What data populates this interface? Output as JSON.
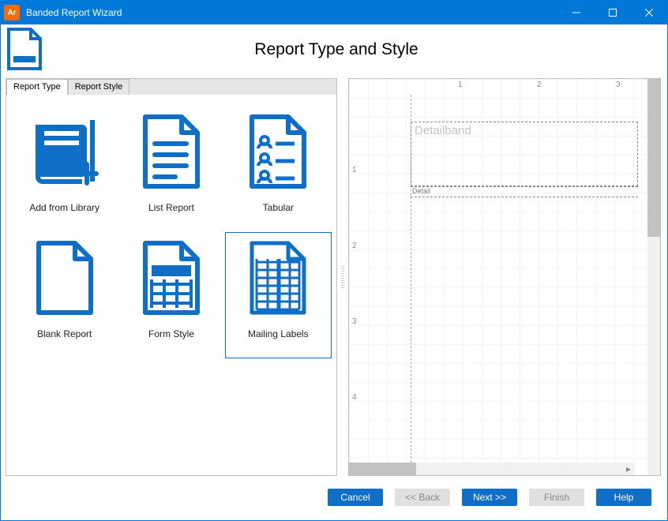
{
  "window": {
    "badge": "Ar",
    "title": "Banded Report Wizard"
  },
  "header": {
    "title": "Report Type and Style"
  },
  "tabs": [
    {
      "label": "Report Type",
      "active": true
    },
    {
      "label": "Report Style",
      "active": false
    }
  ],
  "tiles": [
    {
      "label": "Add from Library",
      "icon": "book-plus",
      "selected": false
    },
    {
      "label": "List Report",
      "icon": "list-doc",
      "selected": false
    },
    {
      "label": "Tabular",
      "icon": "profile-doc",
      "selected": false
    },
    {
      "label": "Blank Report",
      "icon": "blank-doc",
      "selected": false
    },
    {
      "label": "Form Style",
      "icon": "form-doc",
      "selected": false
    },
    {
      "label": "Mailing Labels",
      "icon": "grid-doc",
      "selected": true
    }
  ],
  "preview": {
    "ruler_h": [
      "1",
      "2",
      "3"
    ],
    "ruler_v": [
      "1",
      "2",
      "3",
      "4"
    ],
    "band_label": "Detailband",
    "detail_label": "Detail"
  },
  "buttons": {
    "cancel": "Cancel",
    "back": "<< Back",
    "next": "Next >>",
    "finish": "Finish",
    "help": "Help"
  }
}
